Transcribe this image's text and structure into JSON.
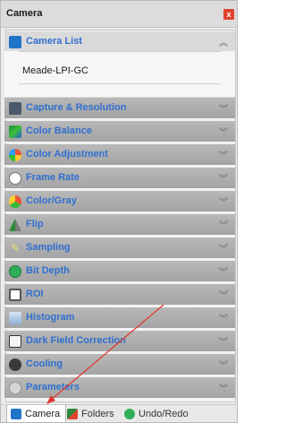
{
  "window": {
    "title": "Camera",
    "close_label": "x"
  },
  "camera_list": {
    "header": "Camera List",
    "selected_camera": "Meade-LPI-GC"
  },
  "sections": [
    "Capture & Resolution",
    "Color Balance",
    "Color Adjustment",
    "Frame Rate",
    "Color/Gray",
    "Flip",
    "Sampling",
    "Bit Depth",
    "ROI",
    "Histogram",
    "Dark Field Correction",
    "Cooling",
    "Parameters"
  ],
  "section_icons": [
    "capture-icon",
    "color-balance-icon",
    "color-adjustment-icon",
    "frame-rate-icon",
    "color-gray-icon",
    "flip-icon",
    "sampling-icon",
    "bit-depth-icon",
    "roi-icon",
    "histogram-icon",
    "dark-field-icon",
    "cooling-icon",
    "parameters-icon"
  ],
  "tabs": {
    "camera": "Camera",
    "folders": "Folders",
    "undo_redo": "Undo/Redo"
  },
  "colors": {
    "section_label": "#2f6fd0",
    "annotation_arrow": "#e0382c"
  }
}
